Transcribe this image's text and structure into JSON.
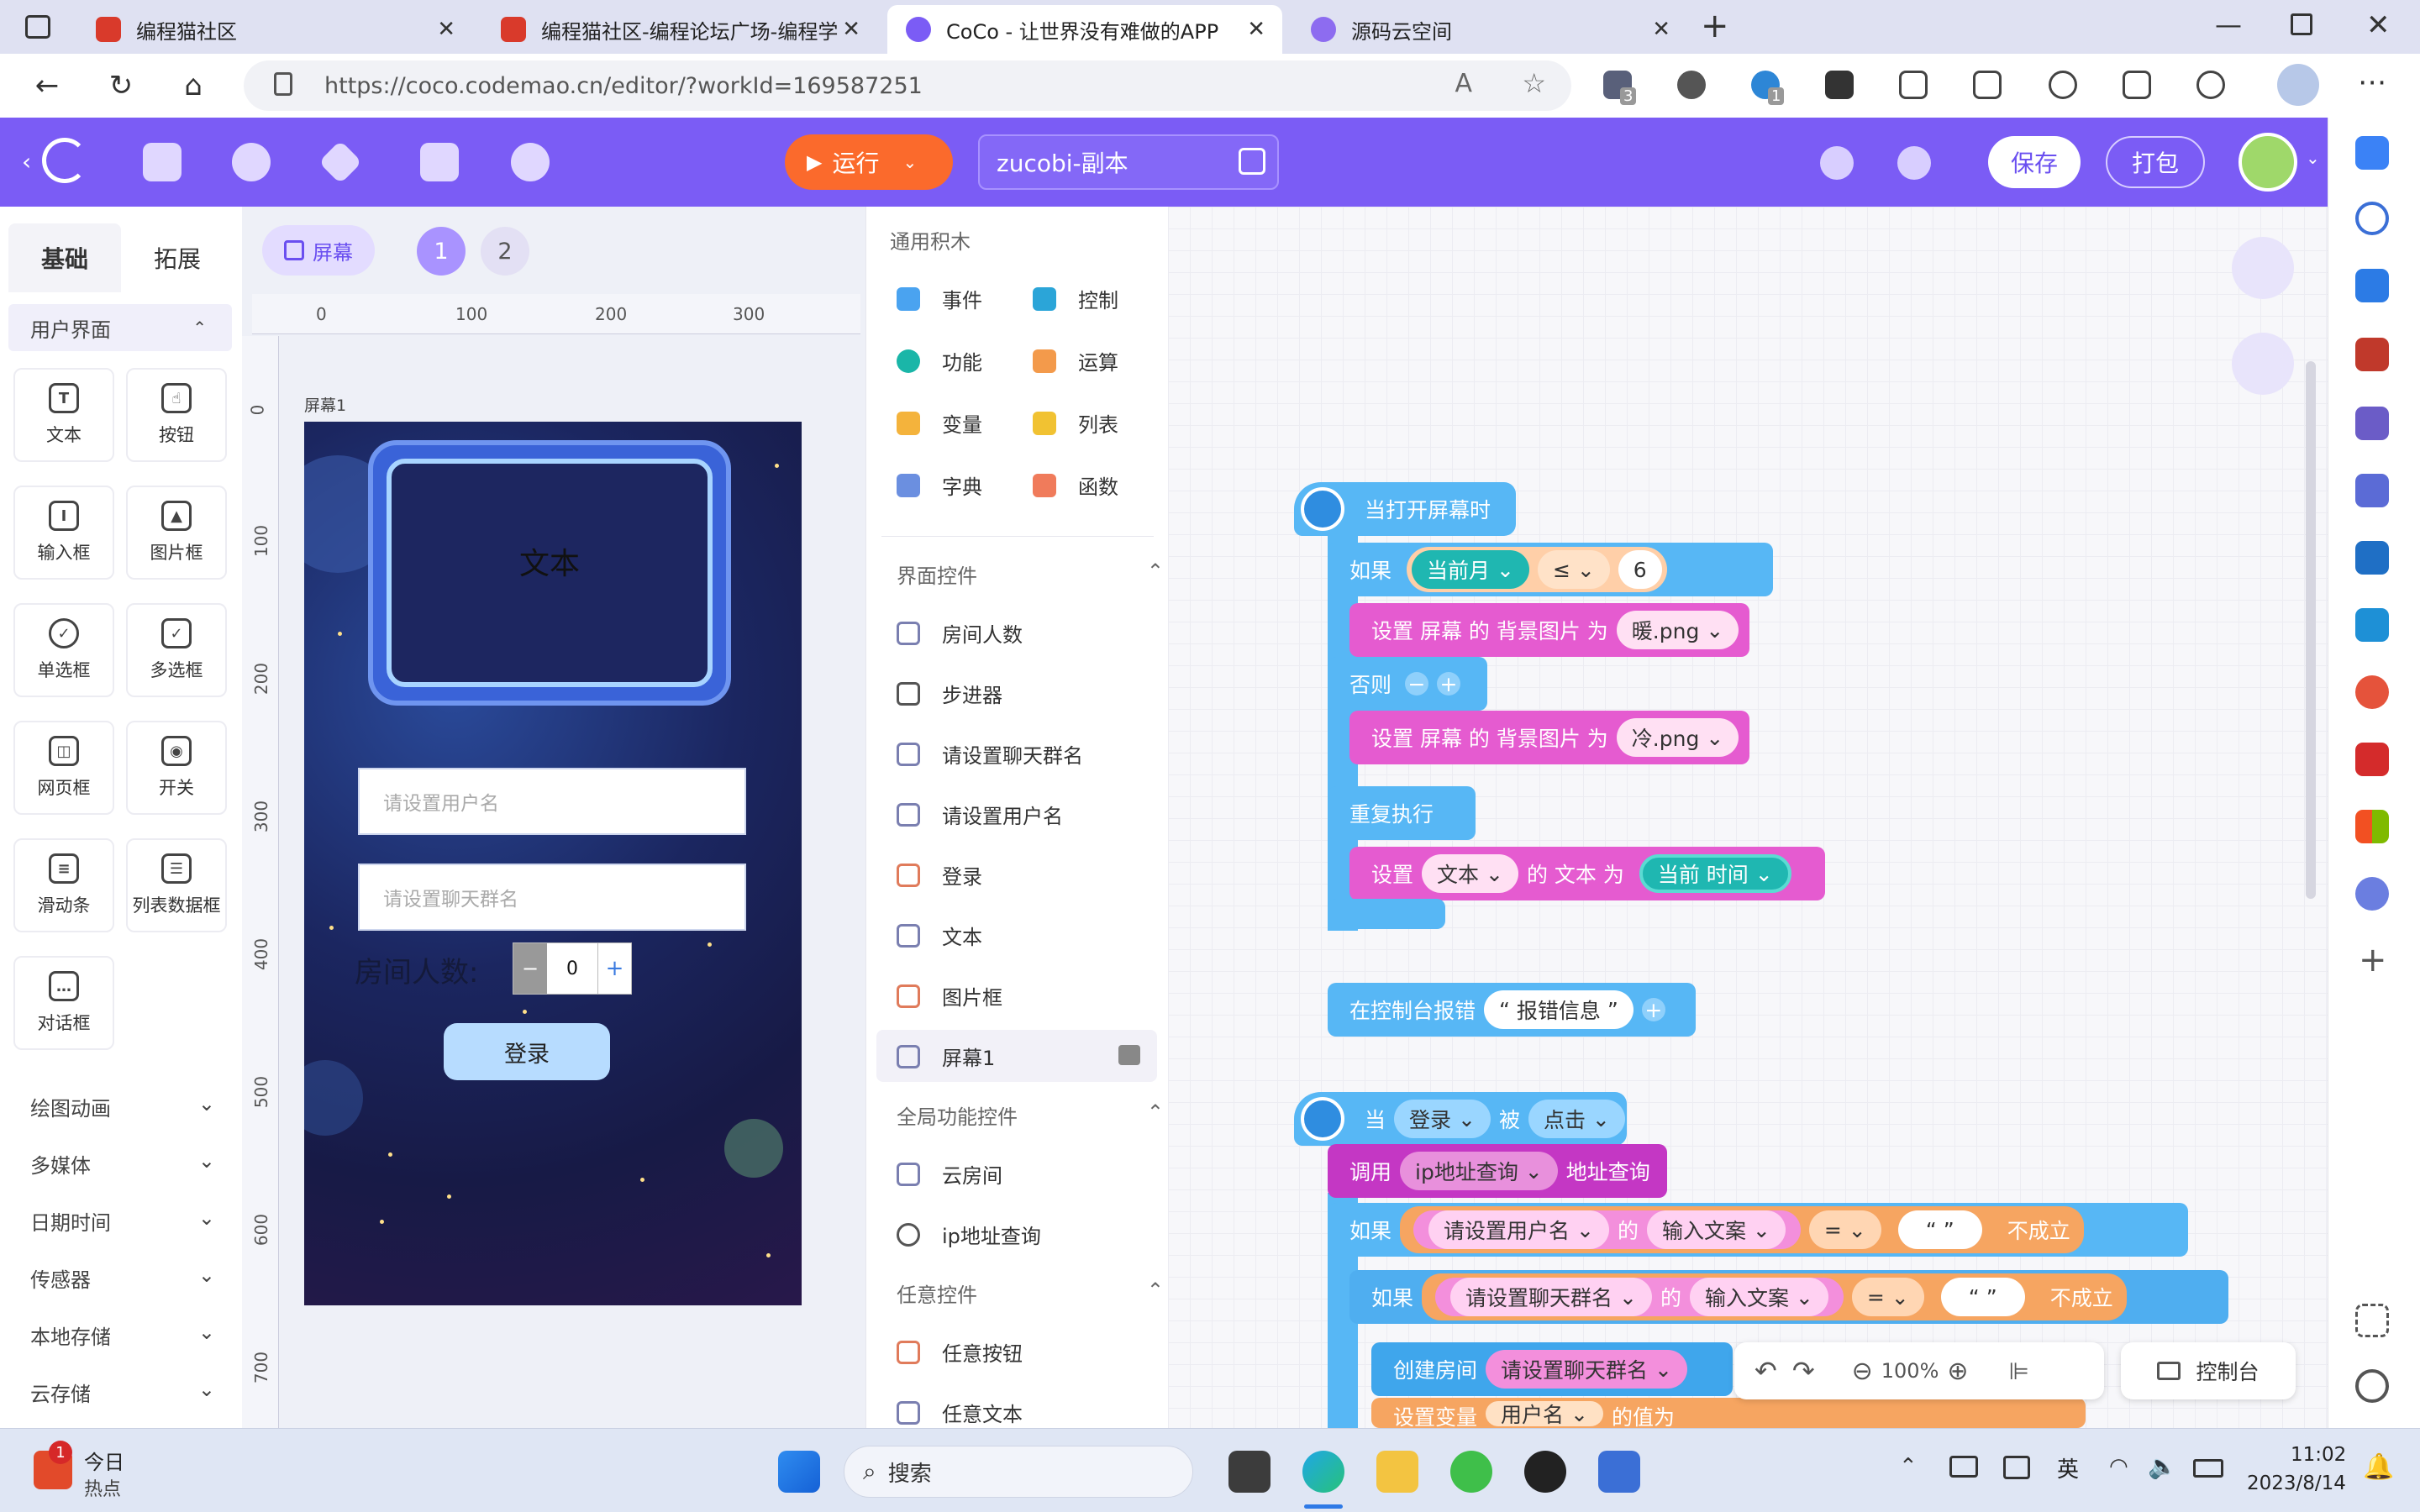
{
  "browser": {
    "tabs": [
      {
        "title": "编程猫社区"
      },
      {
        "title": "编程猫社区-编程论坛广场-编程学"
      },
      {
        "title": "CoCo - 让世界没有难做的APP"
      },
      {
        "title": "源码云空间"
      }
    ],
    "url": "https://coco.codemao.cn/editor/?workId=169587251",
    "ext_badges": [
      "3",
      "1"
    ]
  },
  "toolbar": {
    "run_label": "运行",
    "project_name": "zucobi-副本",
    "save_label": "保存",
    "package_label": "打包"
  },
  "left_panel": {
    "tabs": [
      "基础",
      "拓展"
    ],
    "section_title": "用户界面",
    "widgets": [
      "文本",
      "按钮",
      "输入框",
      "图片框",
      "单选框",
      "多选框",
      "网页框",
      "开关",
      "滑动条",
      "列表数据框",
      "对话框"
    ],
    "categories": [
      "绘图动画",
      "多媒体",
      "日期时间",
      "传感器",
      "本地存储",
      "云存储"
    ]
  },
  "stage": {
    "screen_button": "屏幕",
    "screens": [
      "1",
      "2"
    ],
    "ruler_x": [
      "0",
      "100",
      "200",
      "300"
    ],
    "ruler_y": [
      "0",
      "100",
      "200",
      "300",
      "400",
      "500",
      "600",
      "700"
    ],
    "screen_label": "屏幕1",
    "phone": {
      "text_label": "文本",
      "username_placeholder": "请设置用户名",
      "group_placeholder": "请设置聊天群名",
      "room_count_label": "房间人数:",
      "stepper_minus": "−",
      "stepper_value": "0",
      "stepper_plus": "+",
      "login_button": "登录"
    }
  },
  "palette": {
    "common_title": "通用积木",
    "common": [
      "事件",
      "控制",
      "功能",
      "运算",
      "变量",
      "列表",
      "字典",
      "函数"
    ],
    "ui_controls_title": "界面控件",
    "ui_controls": [
      "房间人数",
      "步进器",
      "请设置聊天群名",
      "请设置用户名",
      "登录",
      "文本",
      "图片框",
      "屏幕1"
    ],
    "global_title": "全局功能控件",
    "global": [
      "云房间",
      "ip地址查询"
    ],
    "any_title": "任意控件",
    "any": [
      "任意按钮",
      "任意文本"
    ]
  },
  "workspace": {
    "b1_hat": "当打开屏幕时",
    "b1_if": "如果",
    "b1_month": "当前月",
    "b1_op": "≤",
    "b1_num": "6",
    "b1_set1_pre": "设置 屏幕 的 背景图片 为",
    "b1_set1_val": "暖.png",
    "b1_else": "否则",
    "b1_set2_pre": "设置 屏幕 的 背景图片 为",
    "b1_set2_val": "冷.png",
    "b1_repeat": "重复执行",
    "b1_set3_a": "设置",
    "b1_set3_obj": "文本",
    "b1_set3_b": "的 文本 为",
    "b1_set3_val": "当前 时间",
    "b2_log": "在控制台报错",
    "b2_msg": "报错信息",
    "b3_when": "当",
    "b3_obj": "登录",
    "b3_by": "被",
    "b3_evt": "点击",
    "b3_call": "调用",
    "b3_ip": "ip地址查询",
    "b3_ip2": "地址查询",
    "b3_if1": "如果",
    "b3_if1_obj": "请设置用户名",
    "b3_of": "的",
    "b3_prop": "输入文案",
    "b3_eq": "=",
    "b3_empty": "“ ”",
    "b3_not": "不成立",
    "b3_if2": "如果",
    "b3_if2_obj": "请设置聊天群名",
    "b3_create": "创建房间",
    "b3_create_obj": "请设置聊天群名",
    "b3_setvar": "设置变量",
    "b3_var": "用户名",
    "b3_valof": "的值为",
    "zoom": "100%",
    "console": "控制台"
  },
  "taskbar": {
    "news_title": "今日",
    "news_sub": "热点",
    "news_badge": "1",
    "search": "搜索",
    "ime": "英",
    "time": "11:02",
    "date": "2023/8/14"
  }
}
